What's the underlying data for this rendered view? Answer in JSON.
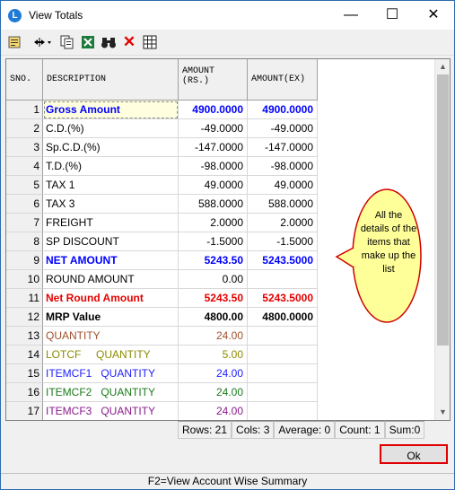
{
  "window": {
    "title": "View Totals",
    "minimize": "—",
    "maximize": "☐",
    "close": "✕"
  },
  "toolbar": {
    "icons": [
      "note-icon",
      "column-width-icon",
      "copy-icon",
      "excel-icon",
      "binoculars-icon",
      "delete-icon",
      "grid-icon"
    ]
  },
  "grid": {
    "headers": {
      "sno": "SNO.",
      "desc": "DESCRIPTION",
      "amt": "AMOUNT\n(RS.)",
      "ex": "AMOUNT(EX)"
    },
    "rows": [
      {
        "sno": "1",
        "desc": "Gross Amount",
        "amt": "4900.0000",
        "ex": "4900.0000",
        "style": "blue"
      },
      {
        "sno": "2",
        "desc": "C.D.(%)",
        "amt": "-49.0000",
        "ex": "-49.0000",
        "style": ""
      },
      {
        "sno": "3",
        "desc": "Sp.C.D.(%)",
        "amt": "-147.0000",
        "ex": "-147.0000",
        "style": ""
      },
      {
        "sno": "4",
        "desc": "T.D.(%)",
        "amt": "-98.0000",
        "ex": "-98.0000",
        "style": ""
      },
      {
        "sno": "5",
        "desc": "TAX 1",
        "amt": "49.0000",
        "ex": "49.0000",
        "style": ""
      },
      {
        "sno": "6",
        "desc": "TAX 3",
        "amt": "588.0000",
        "ex": "588.0000",
        "style": ""
      },
      {
        "sno": "7",
        "desc": "FREIGHT",
        "amt": "2.0000",
        "ex": "2.0000",
        "style": ""
      },
      {
        "sno": "8",
        "desc": "SP DISCOUNT",
        "amt": "-1.5000",
        "ex": "-1.5000",
        "style": ""
      },
      {
        "sno": "9",
        "desc": "NET AMOUNT",
        "amt": "5243.50",
        "ex": "5243.5000",
        "style": "blue"
      },
      {
        "sno": "10",
        "desc": "ROUND AMOUNT",
        "amt": "0.00",
        "ex": "",
        "style": ""
      },
      {
        "sno": "11",
        "desc": "Net Round Amount",
        "amt": "5243.50",
        "ex": "5243.5000",
        "style": "red"
      },
      {
        "sno": "12",
        "desc": "MRP Value",
        "amt": "4800.00",
        "ex": "4800.0000",
        "style": "bold"
      },
      {
        "sno": "13",
        "desc": "QUANTITY",
        "amt": "24.00",
        "ex": "",
        "style": "brown"
      },
      {
        "sno": "14",
        "desc": "LOTCF     QUANTITY",
        "amt": "5.00",
        "ex": "",
        "style": "olive"
      },
      {
        "sno": "15",
        "desc": "ITEMCF1   QUANTITY",
        "amt": "24.00",
        "ex": "",
        "style": "vblue"
      },
      {
        "sno": "16",
        "desc": "ITEMCF2   QUANTITY",
        "amt": "24.00",
        "ex": "",
        "style": "green"
      },
      {
        "sno": "17",
        "desc": "ITEMCF3   QUANTITY",
        "amt": "24.00",
        "ex": "",
        "style": "purple"
      }
    ]
  },
  "callout": {
    "text": "All the details of the items that make up the list"
  },
  "status": {
    "rows": "Rows: 21",
    "cols": "Cols: 3",
    "average": "Average: 0",
    "count": "Count: 1",
    "sum": "Sum:0"
  },
  "ok_label": "Ok",
  "footer": "F2=View Account Wise Summary"
}
